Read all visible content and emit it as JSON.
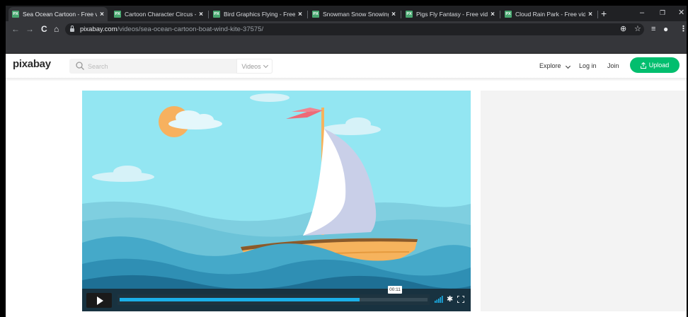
{
  "browser": {
    "tabs": [
      {
        "title": "Sea Ocean Cartoon - Free vi",
        "active": true
      },
      {
        "title": "Cartoon Character Circus - Fr",
        "active": false
      },
      {
        "title": "Bird Graphics Flying - Free vi",
        "active": false
      },
      {
        "title": "Snowman Snow Snowing - Fr",
        "active": false
      },
      {
        "title": "Pigs Fly Fantasy - Free video",
        "active": false
      },
      {
        "title": "Cloud Rain Park - Free video",
        "active": false
      }
    ],
    "favicon_text": "PX",
    "tab_close": "×",
    "new_tab": "+",
    "window_controls": {
      "minimize": "–",
      "restore": "❐",
      "close": "✕"
    },
    "nav": {
      "back": "←",
      "forward": "→",
      "reload": "C",
      "home": "⌂"
    },
    "url_host": "pixabay.com",
    "url_path": "/videos/sea-ocean-cartoon-boat-wind-kite-37575/",
    "toolbar_icons": {
      "zoom": "⊕",
      "bookmark": "☆",
      "media": "≡",
      "profile": "●",
      "menu": "⋮"
    }
  },
  "site": {
    "logo": "pixabay",
    "search_placeholder": "Search",
    "search_scope": "Videos",
    "nav": {
      "explore": "Explore",
      "login": "Log in",
      "join": "Join",
      "upload": "Upload"
    }
  },
  "player": {
    "current_time": "00:11",
    "progress_fraction": 0.78,
    "gear_icon": "✱",
    "colors": {
      "accent": "#1bb0e9",
      "sky": "#93e6f2",
      "upload_green": "#02be6e"
    }
  }
}
